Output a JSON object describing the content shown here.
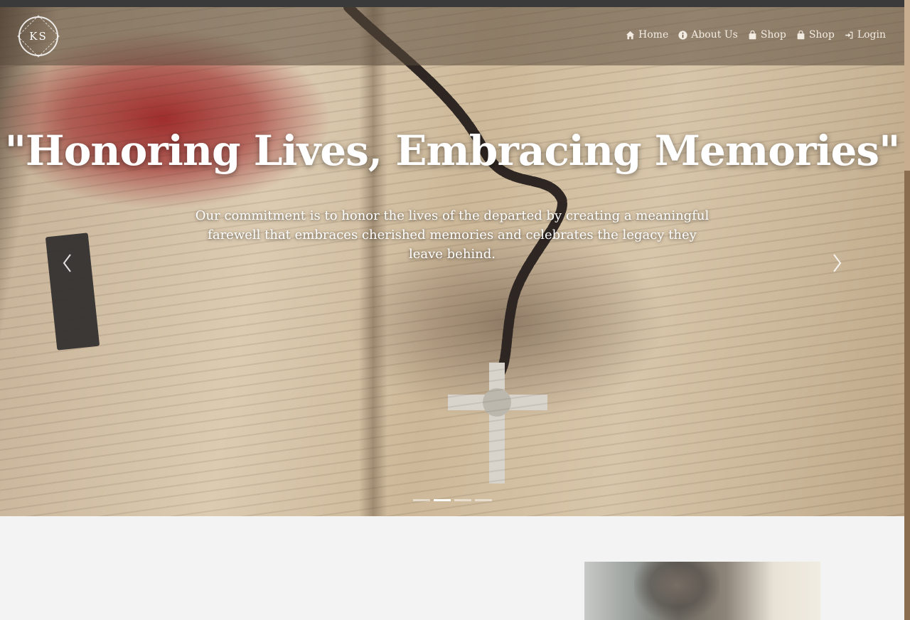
{
  "brand": {
    "logo_text": "KS"
  },
  "nav": {
    "items": [
      {
        "label": "Home",
        "icon": "home-icon"
      },
      {
        "label": "About Us",
        "icon": "info-icon"
      },
      {
        "label": "Shop",
        "icon": "shopping-bag-icon"
      },
      {
        "label": "Shop",
        "icon": "shopping-bag-icon"
      },
      {
        "label": "Login",
        "icon": "login-icon"
      }
    ]
  },
  "hero": {
    "headline": "\"Honoring Lives, Embracing Memories\"",
    "subtext": "Our commitment is to honor the lives of the departed by creating a meaningful farewell that embraces cherished memories and celebrates the legacy they leave behind.",
    "slide_count": 4,
    "active_slide": 2
  },
  "colors": {
    "text_light": "#ffffff",
    "navbar_overlay": "#5a4b3c",
    "scrollbar": "#8a6d4e",
    "page_background": "#f3f3f3"
  }
}
